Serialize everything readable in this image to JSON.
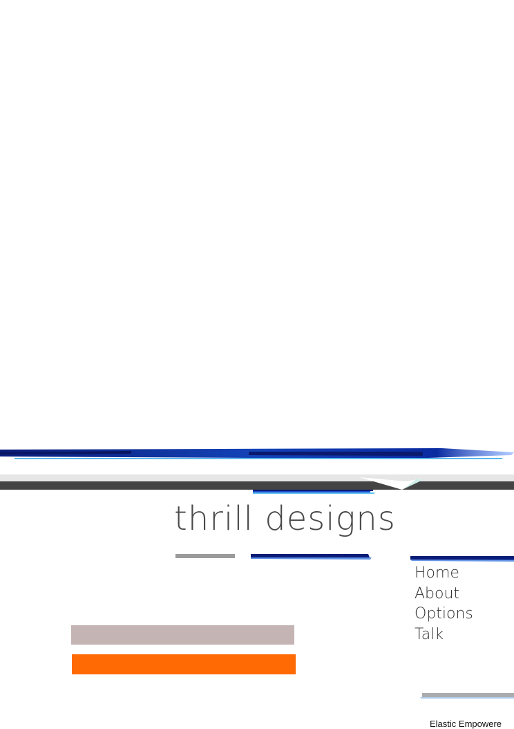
{
  "site": {
    "title": "thrill designs"
  },
  "nav": {
    "items": [
      {
        "label": "Home"
      },
      {
        "label": "About"
      },
      {
        "label": "Options"
      },
      {
        "label": "Talk"
      }
    ]
  },
  "footer": {
    "text": "Elastic Empowere"
  },
  "colors": {
    "band_dark": "#444444",
    "brush_blue": "#0d2a9a",
    "accent_rose": "#c4b5b4",
    "accent_orange": "#ff6a04",
    "nav_text": "#2e2e2e"
  }
}
